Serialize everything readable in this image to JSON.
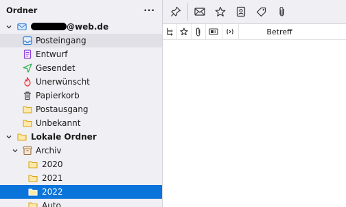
{
  "folder_pane": {
    "title": "Ordner",
    "menu_label": "···"
  },
  "account": {
    "email_suffix": "@web.de"
  },
  "folders": {
    "inbox": "Posteingang",
    "drafts": "Entwurf",
    "sent": "Gesendet",
    "spam": "Unerwünscht",
    "trash": "Papierkorb",
    "outbox": "Postausgang",
    "unknown": "Unbekannt"
  },
  "local": {
    "title": "Lokale Ordner",
    "archive": "Archiv",
    "years": [
      "2020",
      "2021",
      "2022"
    ],
    "auto": "Auto"
  },
  "message_list": {
    "subject_header": "Betreff"
  },
  "icons": {
    "pin": "pin-icon",
    "envelope": "envelope-icon",
    "star": "star-icon",
    "contact": "contact-card-icon",
    "tag": "tag-icon",
    "attachment": "paperclip-icon"
  },
  "colors": {
    "selection": "#0a74da",
    "folder_yellow": "#f5c544",
    "inbox_blue": "#2f7bd6",
    "drafts_purple": "#8e3fd6",
    "sent_green": "#2ea84a",
    "spam_red": "#e0303a"
  }
}
